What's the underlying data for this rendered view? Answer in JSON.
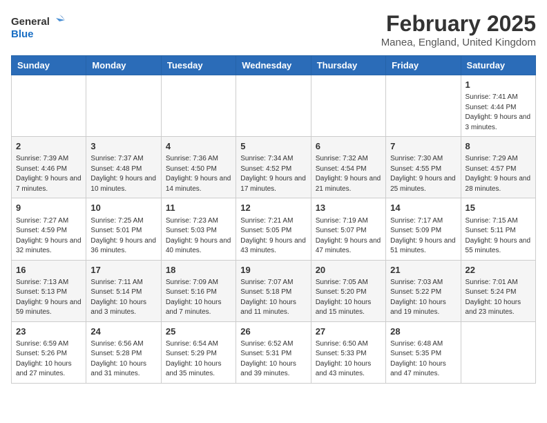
{
  "header": {
    "logo_line1": "General",
    "logo_line2": "Blue",
    "title": "February 2025",
    "subtitle": "Manea, England, United Kingdom"
  },
  "weekdays": [
    "Sunday",
    "Monday",
    "Tuesday",
    "Wednesday",
    "Thursday",
    "Friday",
    "Saturday"
  ],
  "weeks": [
    [
      {
        "day": "",
        "info": ""
      },
      {
        "day": "",
        "info": ""
      },
      {
        "day": "",
        "info": ""
      },
      {
        "day": "",
        "info": ""
      },
      {
        "day": "",
        "info": ""
      },
      {
        "day": "",
        "info": ""
      },
      {
        "day": "1",
        "info": "Sunrise: 7:41 AM\nSunset: 4:44 PM\nDaylight: 9 hours and 3 minutes."
      }
    ],
    [
      {
        "day": "2",
        "info": "Sunrise: 7:39 AM\nSunset: 4:46 PM\nDaylight: 9 hours and 7 minutes."
      },
      {
        "day": "3",
        "info": "Sunrise: 7:37 AM\nSunset: 4:48 PM\nDaylight: 9 hours and 10 minutes."
      },
      {
        "day": "4",
        "info": "Sunrise: 7:36 AM\nSunset: 4:50 PM\nDaylight: 9 hours and 14 minutes."
      },
      {
        "day": "5",
        "info": "Sunrise: 7:34 AM\nSunset: 4:52 PM\nDaylight: 9 hours and 17 minutes."
      },
      {
        "day": "6",
        "info": "Sunrise: 7:32 AM\nSunset: 4:54 PM\nDaylight: 9 hours and 21 minutes."
      },
      {
        "day": "7",
        "info": "Sunrise: 7:30 AM\nSunset: 4:55 PM\nDaylight: 9 hours and 25 minutes."
      },
      {
        "day": "8",
        "info": "Sunrise: 7:29 AM\nSunset: 4:57 PM\nDaylight: 9 hours and 28 minutes."
      }
    ],
    [
      {
        "day": "9",
        "info": "Sunrise: 7:27 AM\nSunset: 4:59 PM\nDaylight: 9 hours and 32 minutes."
      },
      {
        "day": "10",
        "info": "Sunrise: 7:25 AM\nSunset: 5:01 PM\nDaylight: 9 hours and 36 minutes."
      },
      {
        "day": "11",
        "info": "Sunrise: 7:23 AM\nSunset: 5:03 PM\nDaylight: 9 hours and 40 minutes."
      },
      {
        "day": "12",
        "info": "Sunrise: 7:21 AM\nSunset: 5:05 PM\nDaylight: 9 hours and 43 minutes."
      },
      {
        "day": "13",
        "info": "Sunrise: 7:19 AM\nSunset: 5:07 PM\nDaylight: 9 hours and 47 minutes."
      },
      {
        "day": "14",
        "info": "Sunrise: 7:17 AM\nSunset: 5:09 PM\nDaylight: 9 hours and 51 minutes."
      },
      {
        "day": "15",
        "info": "Sunrise: 7:15 AM\nSunset: 5:11 PM\nDaylight: 9 hours and 55 minutes."
      }
    ],
    [
      {
        "day": "16",
        "info": "Sunrise: 7:13 AM\nSunset: 5:13 PM\nDaylight: 9 hours and 59 minutes."
      },
      {
        "day": "17",
        "info": "Sunrise: 7:11 AM\nSunset: 5:14 PM\nDaylight: 10 hours and 3 minutes."
      },
      {
        "day": "18",
        "info": "Sunrise: 7:09 AM\nSunset: 5:16 PM\nDaylight: 10 hours and 7 minutes."
      },
      {
        "day": "19",
        "info": "Sunrise: 7:07 AM\nSunset: 5:18 PM\nDaylight: 10 hours and 11 minutes."
      },
      {
        "day": "20",
        "info": "Sunrise: 7:05 AM\nSunset: 5:20 PM\nDaylight: 10 hours and 15 minutes."
      },
      {
        "day": "21",
        "info": "Sunrise: 7:03 AM\nSunset: 5:22 PM\nDaylight: 10 hours and 19 minutes."
      },
      {
        "day": "22",
        "info": "Sunrise: 7:01 AM\nSunset: 5:24 PM\nDaylight: 10 hours and 23 minutes."
      }
    ],
    [
      {
        "day": "23",
        "info": "Sunrise: 6:59 AM\nSunset: 5:26 PM\nDaylight: 10 hours and 27 minutes."
      },
      {
        "day": "24",
        "info": "Sunrise: 6:56 AM\nSunset: 5:28 PM\nDaylight: 10 hours and 31 minutes."
      },
      {
        "day": "25",
        "info": "Sunrise: 6:54 AM\nSunset: 5:29 PM\nDaylight: 10 hours and 35 minutes."
      },
      {
        "day": "26",
        "info": "Sunrise: 6:52 AM\nSunset: 5:31 PM\nDaylight: 10 hours and 39 minutes."
      },
      {
        "day": "27",
        "info": "Sunrise: 6:50 AM\nSunset: 5:33 PM\nDaylight: 10 hours and 43 minutes."
      },
      {
        "day": "28",
        "info": "Sunrise: 6:48 AM\nSunset: 5:35 PM\nDaylight: 10 hours and 47 minutes."
      },
      {
        "day": "",
        "info": ""
      }
    ]
  ]
}
